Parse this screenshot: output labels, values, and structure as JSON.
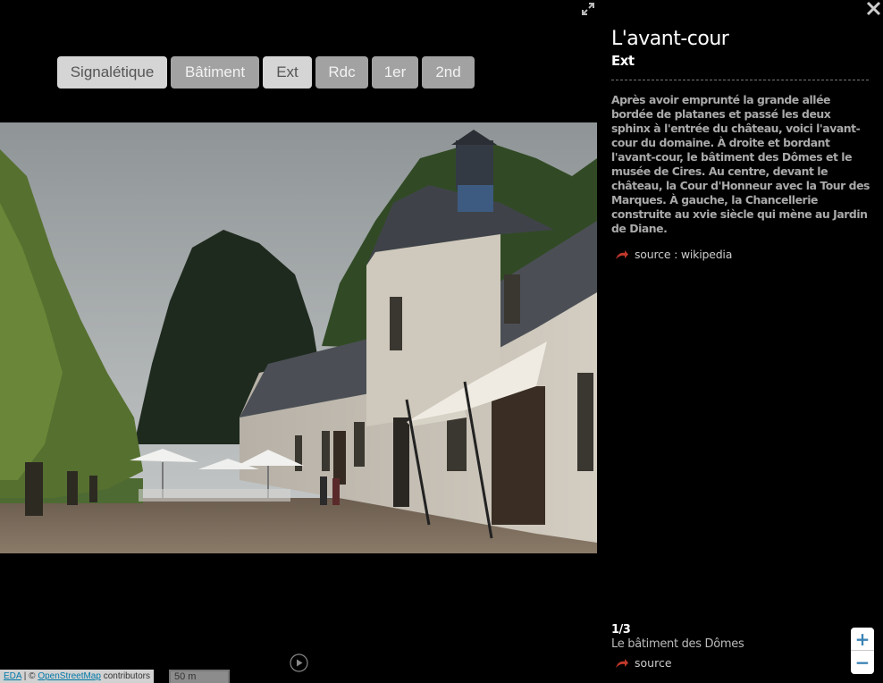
{
  "toolbar": {
    "buttons": [
      {
        "label": "Signalétique"
      },
      {
        "label": "Bâtiment"
      },
      {
        "label": "Ext"
      },
      {
        "label": "Rdc"
      },
      {
        "label": "1er"
      },
      {
        "label": "2nd"
      }
    ]
  },
  "info": {
    "title": "L'avant-cour",
    "subtitle": "Ext",
    "description": "Après avoir emprunté la grande allée bordée de platanes et passé les deux sphinx à l'entrée du château, voici l'avant-cour du domaine. À droite et bordant l'avant-cour, le bâtiment des Dômes et le musée de Cires. Au centre, devant le château, la Cour d'Honneur avec la Tour des Marques. À gauche, la Chancellerie construite au xvie siècle qui mène au Jardin de Diane.",
    "source_label": "source : wikipedia"
  },
  "footer": {
    "counter": "1/3",
    "building": "Le bâtiment des Dômes",
    "source_label": "source"
  },
  "zoom": {
    "plus": "+",
    "minus": "−"
  },
  "attribution": {
    "eda": "EDA",
    "sep": " | © ",
    "osm": "OpenStreetMap",
    "contrib": " contributors"
  },
  "scale": {
    "label": "50 m"
  },
  "icons": {
    "fullscreen": "fullscreen-icon",
    "close": "close-icon",
    "source": "source-arrow-icon",
    "play": "play-icon"
  },
  "colors": {
    "arrow": "#c0392b",
    "zoom": "#3b83b6"
  }
}
